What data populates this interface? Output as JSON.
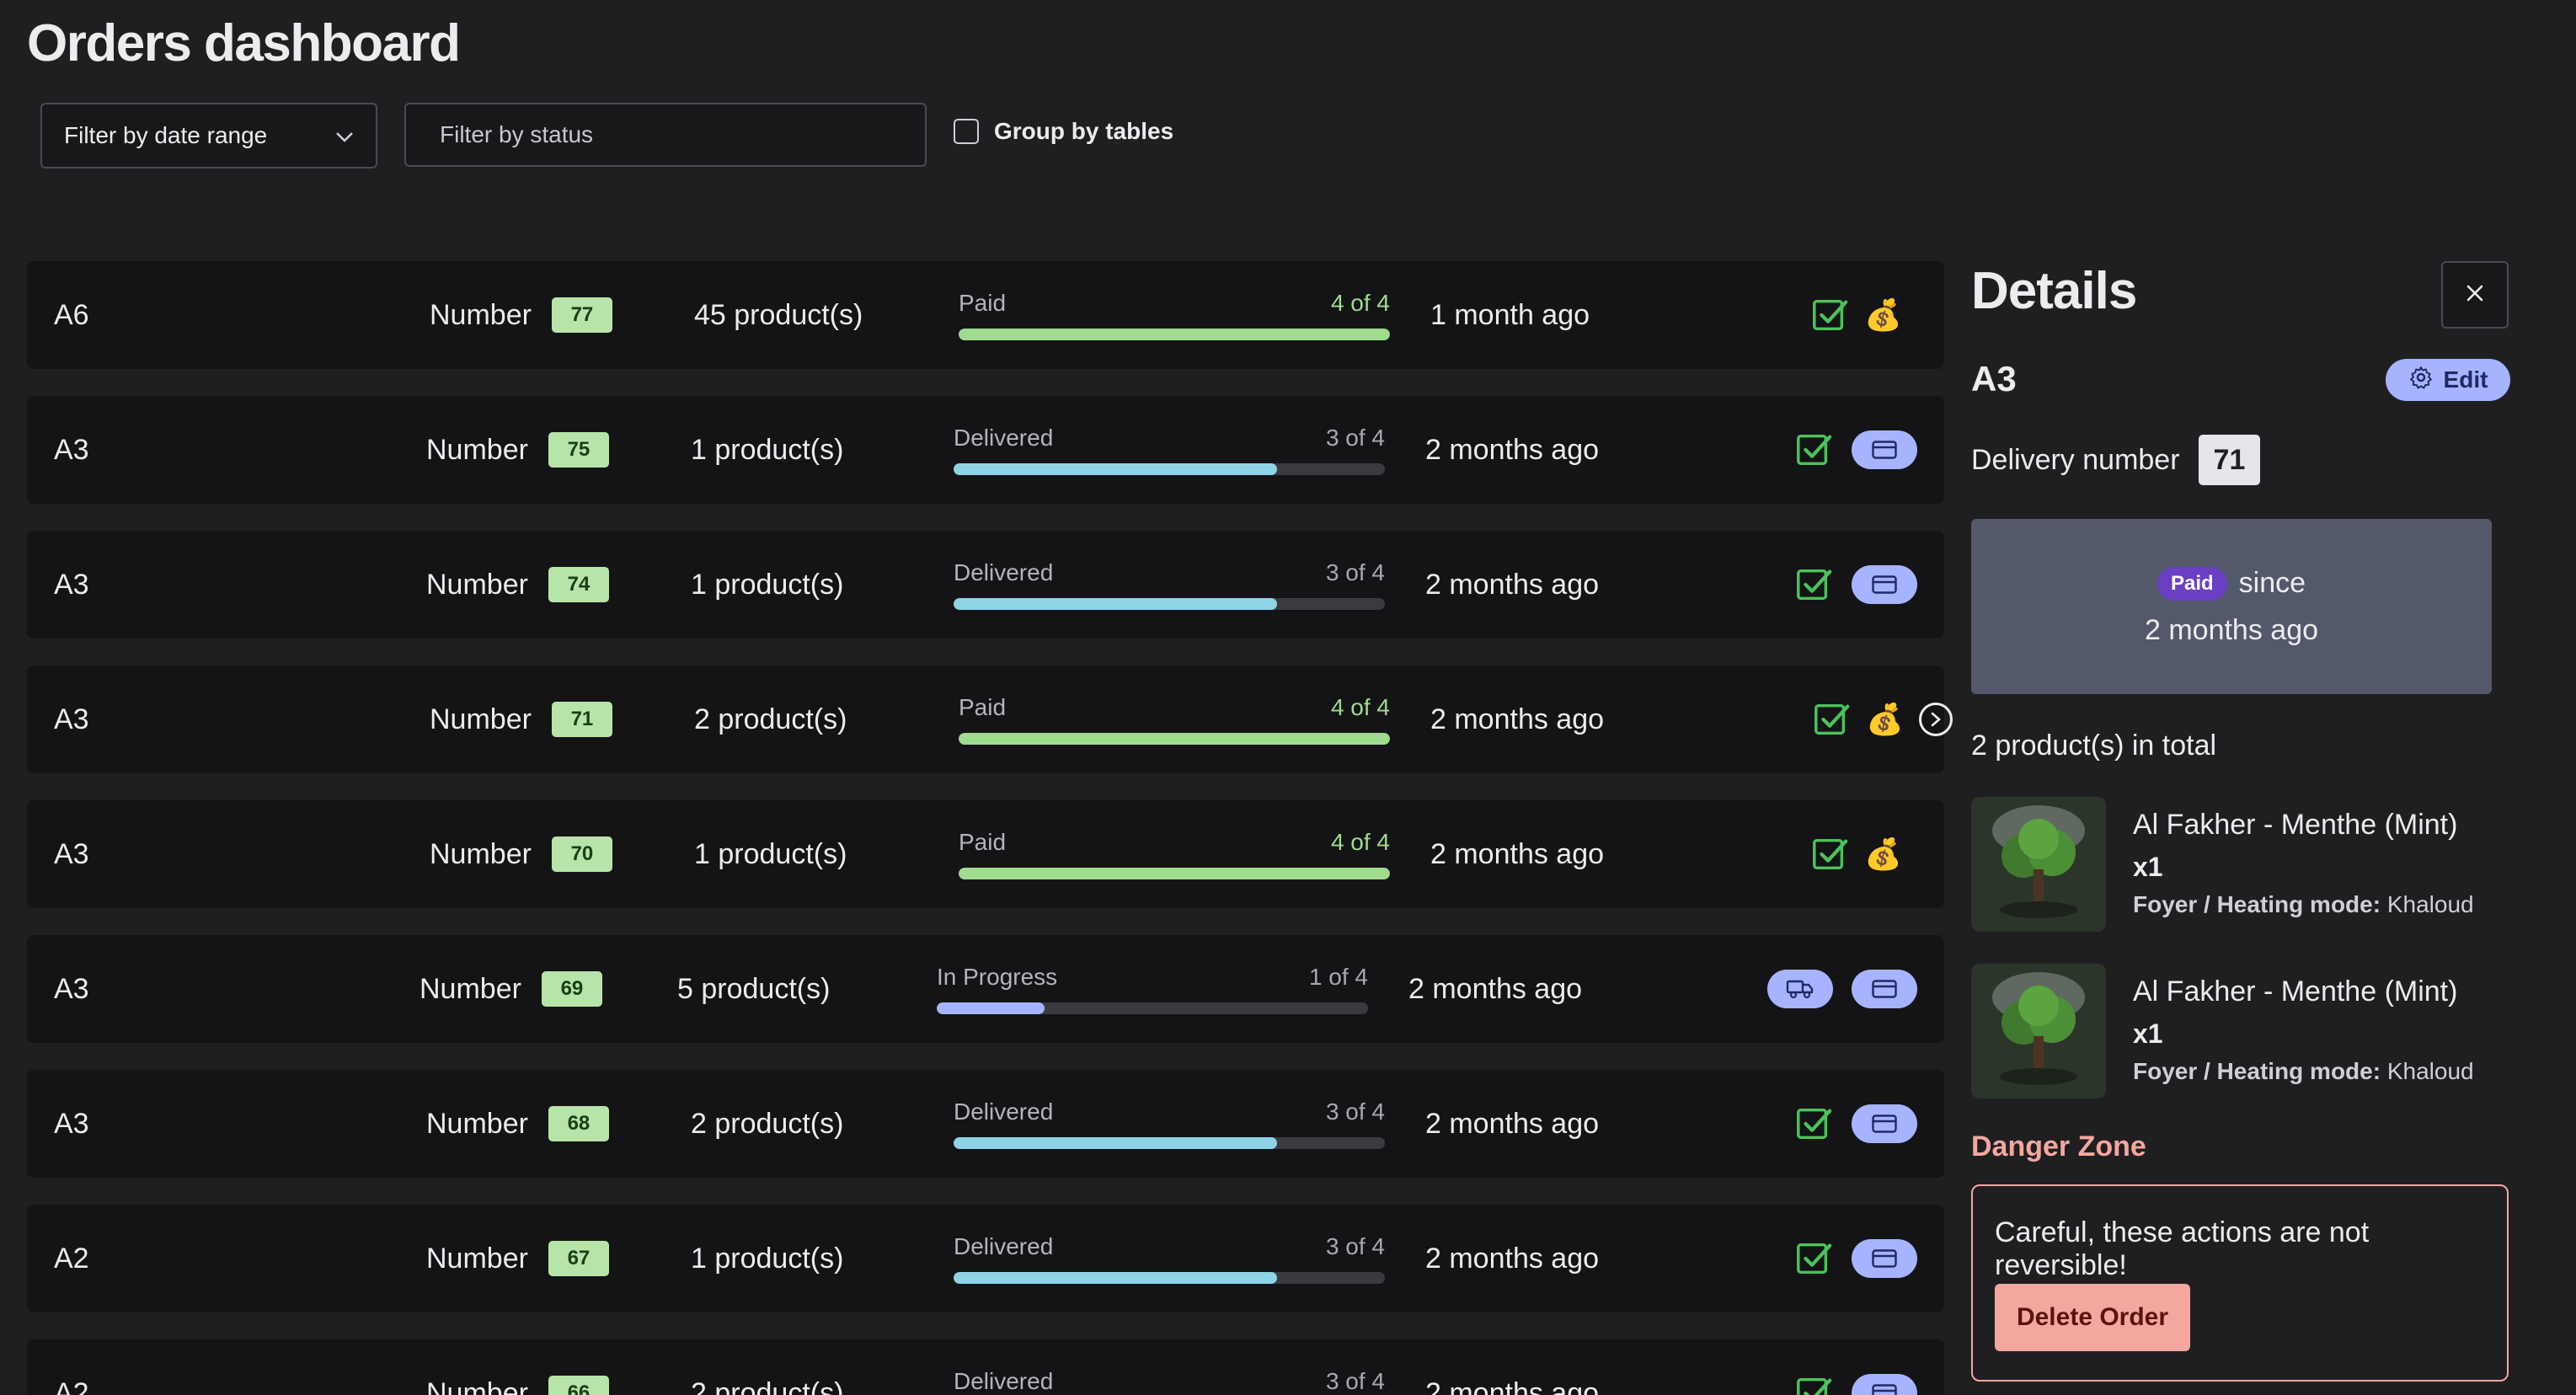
{
  "page": {
    "title": "Orders dashboard"
  },
  "filters": {
    "date_range_label": "Filter by date range",
    "status_placeholder": "Filter by status",
    "group_by_label": "Group by tables",
    "group_by_checked": false
  },
  "orders": [
    {
      "table": "A6",
      "number_label": "Number",
      "number": "77",
      "products": "45 product(s)",
      "status": "Paid",
      "step": "4 of 4",
      "progress": 1.0,
      "time": "1 month ago",
      "actions": [
        "check",
        "money-bag"
      ]
    },
    {
      "table": "A3",
      "number_label": "Number",
      "number": "75",
      "products": "1 product(s)",
      "status": "Delivered",
      "step": "3 of 4",
      "progress": 0.75,
      "time": "2 months ago",
      "actions": [
        "check",
        "card"
      ]
    },
    {
      "table": "A3",
      "number_label": "Number",
      "number": "74",
      "products": "1 product(s)",
      "status": "Delivered",
      "step": "3 of 4",
      "progress": 0.75,
      "time": "2 months ago",
      "actions": [
        "check",
        "card"
      ]
    },
    {
      "table": "A3",
      "number_label": "Number",
      "number": "71",
      "products": "2 product(s)",
      "status": "Paid",
      "step": "4 of 4",
      "progress": 1.0,
      "time": "2 months ago",
      "actions": [
        "check",
        "money-bag",
        "chevron"
      ]
    },
    {
      "table": "A3",
      "number_label": "Number",
      "number": "70",
      "products": "1 product(s)",
      "status": "Paid",
      "step": "4 of 4",
      "progress": 1.0,
      "time": "2 months ago",
      "actions": [
        "check",
        "money-bag"
      ]
    },
    {
      "table": "A3",
      "number_label": "Number",
      "number": "69",
      "products": "5 product(s)",
      "status": "In Progress",
      "step": "1 of 4",
      "progress": 0.25,
      "time": "2 months ago",
      "actions": [
        "truck",
        "card"
      ]
    },
    {
      "table": "A3",
      "number_label": "Number",
      "number": "68",
      "products": "2 product(s)",
      "status": "Delivered",
      "step": "3 of 4",
      "progress": 0.75,
      "time": "2 months ago",
      "actions": [
        "check",
        "card"
      ]
    },
    {
      "table": "A2",
      "number_label": "Number",
      "number": "67",
      "products": "1 product(s)",
      "status": "Delivered",
      "step": "3 of 4",
      "progress": 0.75,
      "time": "2 months ago",
      "actions": [
        "check",
        "card"
      ]
    },
    {
      "table": "A2",
      "number_label": "Number",
      "number": "66",
      "products": "2 product(s)",
      "status": "Delivered",
      "step": "3 of 4",
      "progress": 0.75,
      "time": "2 months ago",
      "actions": [
        "check",
        "card"
      ]
    }
  ],
  "details": {
    "title": "Details",
    "table": "A3",
    "edit_label": "Edit",
    "delivery_label": "Delivery number",
    "delivery_number": "71",
    "status_badge": "Paid",
    "since_label": "since",
    "since_time": "2 months ago",
    "total": "2 product(s) in total",
    "products": [
      {
        "name": "Al Fakher - Menthe (Mint)",
        "qty": "x1",
        "mode_label": "Foyer / Heating mode:",
        "mode_value": "Khaloud"
      },
      {
        "name": "Al Fakher - Menthe (Mint)",
        "qty": "x1",
        "mode_label": "Foyer / Heating mode:",
        "mode_value": "Khaloud"
      }
    ],
    "danger_title": "Danger Zone",
    "danger_message": "Careful, these actions are not reversible!",
    "delete_label": "Delete Order"
  },
  "colors": {
    "paid": "#9fdc8f",
    "delivered": "#8fd3e6",
    "in_progress": "#a6b4ff",
    "badge_bg": "#b7e4a8",
    "check": "#4cc35a",
    "danger": "#f4a79f"
  }
}
